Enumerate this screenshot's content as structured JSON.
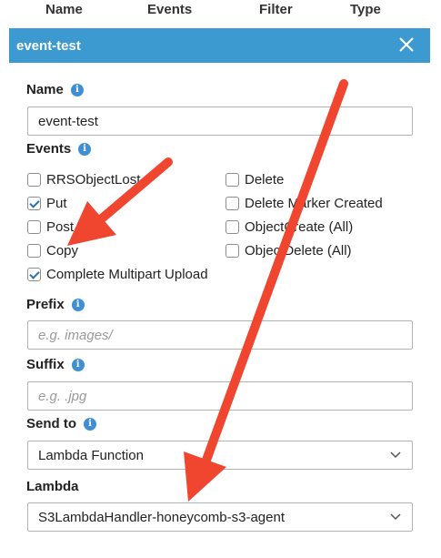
{
  "table_headers": [
    "Name",
    "Events",
    "Filter",
    "Type"
  ],
  "panel": {
    "title": "event-test"
  },
  "name_field": {
    "label": "Name",
    "value": "event-test"
  },
  "events": {
    "label": "Events",
    "left": [
      {
        "label": "RRSObjectLost",
        "checked": false
      },
      {
        "label": "Put",
        "checked": true
      },
      {
        "label": "Post",
        "checked": false
      },
      {
        "label": "Copy",
        "checked": false
      },
      {
        "label": "Complete Multipart Upload",
        "checked": true
      }
    ],
    "right": [
      {
        "label": "Delete",
        "checked": false
      },
      {
        "label": "Delete Marker Created",
        "checked": false
      },
      {
        "label": "ObjectCreate (All)",
        "checked": false
      },
      {
        "label": "ObjectDelete (All)",
        "checked": false
      }
    ]
  },
  "prefix": {
    "label": "Prefix",
    "placeholder": "e.g. images/"
  },
  "suffix": {
    "label": "Suffix",
    "placeholder": "e.g. .jpg"
  },
  "send_to": {
    "label": "Send to",
    "value": "Lambda Function"
  },
  "lambda": {
    "label": "Lambda",
    "value": "S3LambdaHandler-honeycomb-s3-agent"
  },
  "colors": {
    "header": "#3d9ad1",
    "info": "#3f8fd2",
    "arrow": "#f0452f"
  }
}
